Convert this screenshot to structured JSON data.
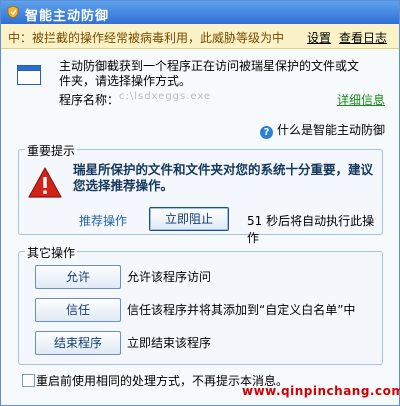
{
  "window": {
    "title": "智能主动防御"
  },
  "warning_bar": {
    "text": "中：被拦截的操作经常被病毒利用，此威胁等级为中",
    "settings_link": "设置",
    "log_link": "查看日志"
  },
  "info": {
    "description": "主动防御截获到一个程序正在访问被瑞星保护的文件或文件夹，请选择操作方式。",
    "program_label": "程序名称：",
    "program_name": "c:\\lsdxeggs.exe",
    "detail_link": "详细信息",
    "help_link": "什么是智能主动防御"
  },
  "important": {
    "legend": "重要提示",
    "text": "瑞星所保护的文件和文件夹对您的系统十分重要，建议您选择推荐操作。",
    "recommend_label": "推荐操作",
    "block_now_button": "立即阻止",
    "countdown": "51 秒后将自动执行此操作"
  },
  "other_ops": {
    "legend": "其它操作",
    "items": [
      {
        "button": "允许",
        "description": "允许该程序访问"
      },
      {
        "button": "信任",
        "description": "信任该程序并将其添加到“自定义白名单”中"
      },
      {
        "button": "结束程序",
        "description": "立即结束该程序"
      }
    ]
  },
  "footer": {
    "checkbox_label": "重启前使用相同的处理方式，不再提示本消息。",
    "checked": false,
    "watermark": "www.qinpinchang.com"
  },
  "colors": {
    "title_bar": "#2f6fd2",
    "warning_bg": "#fbf3c7",
    "detail_link": "#1d8a1d",
    "watermark": "#d10000",
    "alert_red": "#d2231b"
  },
  "icons": {
    "title": "shield-icon",
    "program": "window-icon",
    "help": "help-question-icon",
    "alert": "warning-triangle-icon"
  }
}
